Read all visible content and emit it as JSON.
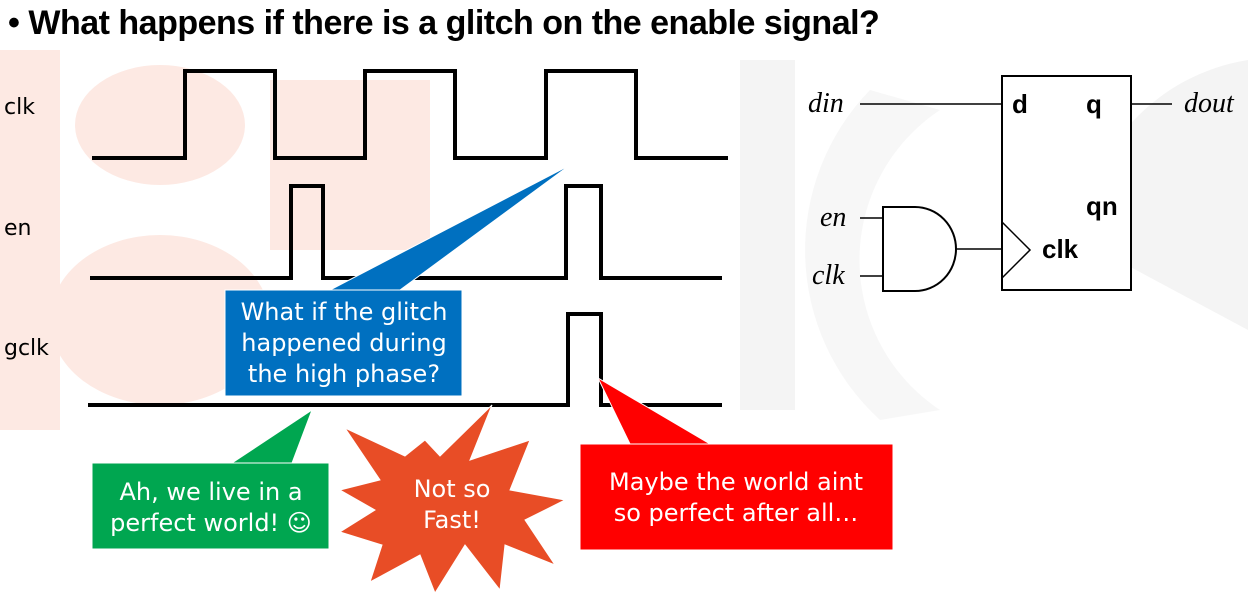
{
  "title": "What happens if there is a glitch on the enable signal?",
  "bullet": "•",
  "waveforms": {
    "labels": [
      "clk",
      "en",
      "gclk"
    ]
  },
  "callouts": {
    "blue": [
      "What if the glitch",
      "happened during",
      "the high phase?"
    ],
    "green": [
      "Ah, we live in a",
      "perfect world! ☺"
    ],
    "star": [
      "Not so",
      "Fast!"
    ],
    "red": [
      "Maybe the world aint",
      "so perfect after all…"
    ]
  },
  "schematic": {
    "din": "din",
    "dout": "dout",
    "en": "en",
    "clk_in": "clk",
    "ff_d": "d",
    "ff_q": "q",
    "ff_qn": "qn",
    "ff_clk": "clk"
  },
  "colors": {
    "blue_callout": "#0070c0",
    "green_callout": "#00a650",
    "star_burst": "#e84d26",
    "red_callout": "#ff0000",
    "watermark": "#fde9e3",
    "watermark_gray": "#f2f2f2"
  }
}
